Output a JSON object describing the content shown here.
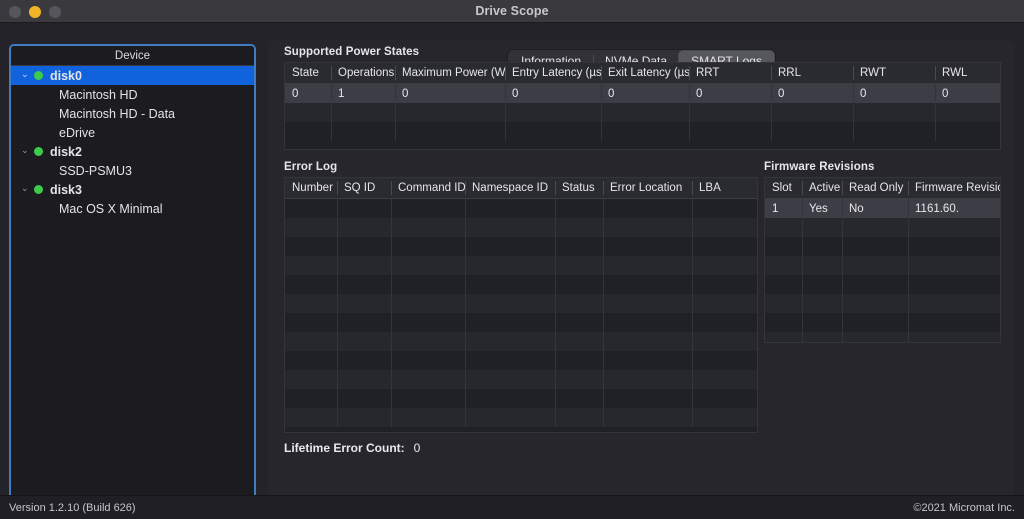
{
  "window": {
    "title": "Drive Scope",
    "traffic_lights": [
      "close-button",
      "minimize-button",
      "zoom-button"
    ]
  },
  "sidebar": {
    "header": "Device",
    "items": [
      {
        "label": "disk0",
        "type": "group",
        "expanded": true,
        "status": "ok",
        "selected": true
      },
      {
        "label": "Macintosh HD",
        "type": "volume"
      },
      {
        "label": "Macintosh HD - Data",
        "type": "volume"
      },
      {
        "label": "eDrive",
        "type": "volume"
      },
      {
        "label": "disk2",
        "type": "group",
        "expanded": true,
        "status": "ok",
        "selected": false
      },
      {
        "label": "SSD-PSMU3",
        "type": "volume"
      },
      {
        "label": "disk3",
        "type": "group",
        "expanded": true,
        "status": "ok",
        "selected": false
      },
      {
        "label": "Mac OS X Minimal",
        "type": "volume"
      }
    ]
  },
  "tabs": [
    {
      "label": "Information",
      "active": false
    },
    {
      "label": "NVMe Data",
      "active": false
    },
    {
      "label": "SMART Logs",
      "active": true
    }
  ],
  "power_states": {
    "title": "Supported Power States",
    "columns": [
      "State",
      "Operations",
      "Maximum Power (W)",
      "Entry Latency (µs)",
      "Exit Latency (µs)",
      "RRT",
      "RRL",
      "RWT",
      "RWL"
    ],
    "rows": [
      [
        "0",
        "1",
        "0",
        "0",
        "0",
        "0",
        "0",
        "0",
        "0"
      ]
    ],
    "empty_rows": 2
  },
  "error_log": {
    "title": "Error Log",
    "columns": [
      "Number",
      "SQ ID",
      "Command ID",
      "Namespace ID",
      "Status",
      "Error Location",
      "LBA"
    ],
    "rows": [],
    "empty_rows": 12
  },
  "firmware_revisions": {
    "title": "Firmware Revisions",
    "columns": [
      "Slot",
      "Active",
      "Read Only",
      "Firmware Revision"
    ],
    "rows": [
      [
        "1",
        "Yes",
        "No",
        "1161.60."
      ]
    ],
    "empty_rows": 7
  },
  "lifetime_error_count": {
    "label": "Lifetime Error Count:",
    "value": "0"
  },
  "statusbar": {
    "version": "Version 1.2.10 (Build 626)",
    "copyright": "©2021 Micromat Inc."
  },
  "colors": {
    "window_bg": "#232329",
    "panel_bg": "#26262c",
    "titlebar_bg": "#3a3a3e",
    "sidebar_bg": "#1b1b20",
    "focus_ring": "#3f7cc0",
    "selection_blue": "#1162dd",
    "status_green": "#3ecb4b",
    "minimize_yellow": "#f0b429",
    "row_highlight": "#3d3d45"
  }
}
